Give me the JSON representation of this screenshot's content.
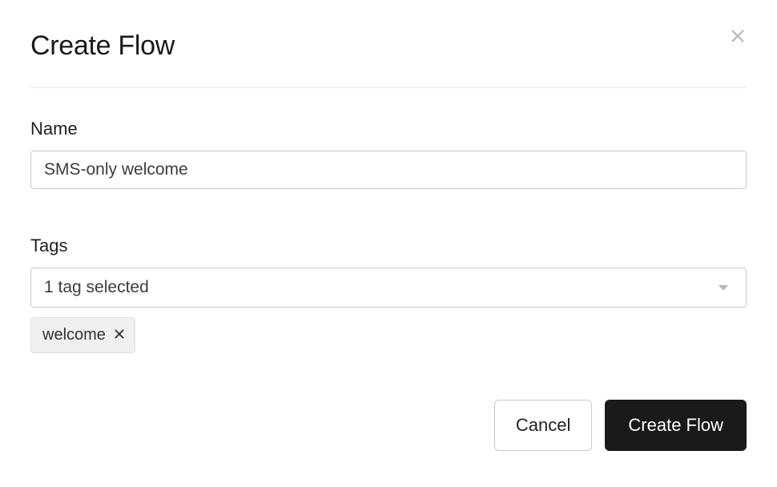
{
  "modal": {
    "title": "Create Flow"
  },
  "form": {
    "name_label": "Name",
    "name_value": "SMS-only welcome",
    "tags_label": "Tags",
    "tags_selected_text": "1 tag selected",
    "tag_chips": [
      {
        "label": "welcome"
      }
    ]
  },
  "buttons": {
    "cancel": "Cancel",
    "submit": "Create Flow"
  }
}
